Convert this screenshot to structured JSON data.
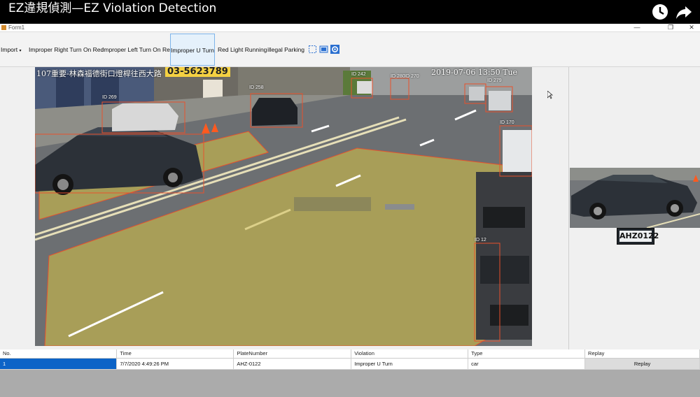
{
  "video_title": "EZ違規偵測—EZ Violation Detection",
  "window": {
    "title": "Form1",
    "controls": {
      "minimize": "—",
      "maximize": "❐",
      "close": "✕"
    }
  },
  "toolbar": {
    "import_label": "Import",
    "items": [
      "Improper Right Turn On Red",
      "Improper Left Turn On Red",
      "Improper U Turn",
      "Red Light Running",
      "illegal Parking"
    ],
    "active_item": "Improper U Turn",
    "icons": [
      "select-region-icon",
      "crop-icon",
      "settings-gear-icon"
    ]
  },
  "video": {
    "location_text": "107重要‑林森福德街口燈桿往西大路",
    "timestamp_text": "2019‑07‑06 13:50 Tue",
    "phone_sign": "03-5623789",
    "detection_ids": [
      "ID 269",
      "ID 258",
      "ID 242",
      "ID 280",
      "ID 270",
      "ID 279",
      "ID 170",
      "ID 12"
    ],
    "zone_color": "#c9b74a",
    "box_color": "#e8512c"
  },
  "side_panel": {
    "plate_text": "AHZ0122"
  },
  "grid": {
    "columns": [
      "No.",
      "Time",
      "PlateNumber",
      "Violation",
      "Type",
      "Replay"
    ],
    "rows": [
      {
        "no": "1",
        "time": "7/7/2020 4:49:26 PM",
        "plate": "AHZ-0122",
        "violation": "Improper U Turn",
        "type": "car",
        "replay": "Replay"
      }
    ]
  }
}
